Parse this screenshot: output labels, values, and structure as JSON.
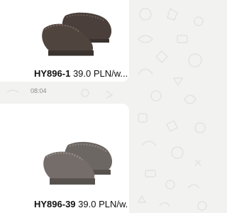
{
  "messages": [
    {
      "product_code": "HY896-1",
      "price_text": "39.0 PLN/w...",
      "image_subject": "dark brown suede slipper pair"
    },
    {
      "product_code": "HY896-39",
      "price_text": "39.0 PLN/w...",
      "image_subject": "grey suede slipper pair"
    }
  ],
  "timestamp": "08:04",
  "colors": {
    "chat_background": "#f2f2f0",
    "bubble_background": "#ffffff",
    "slipper_brown": "#4a3f3b",
    "slipper_grey": "#6d6764",
    "doodle": "#e2e2df"
  }
}
